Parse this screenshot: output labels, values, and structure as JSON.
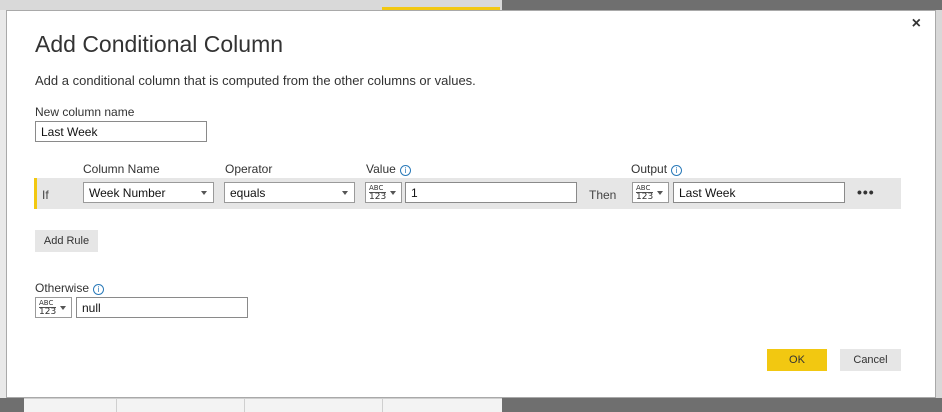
{
  "dialog": {
    "title": "Add Conditional Column",
    "description": "Add a conditional column that is computed from the other columns or values.",
    "close_icon": "×"
  },
  "new_column": {
    "label": "New column name",
    "value": "Last Week"
  },
  "headers": {
    "column_name": "Column Name",
    "operator": "Operator",
    "value": "Value",
    "output": "Output",
    "info_icon": "i"
  },
  "rule": {
    "if_label": "If",
    "column": "Week Number",
    "operator": "equals",
    "value_type_top": "ABC",
    "value_type_bottom": "123",
    "value": "1",
    "then_label": "Then",
    "output_type_top": "ABC",
    "output_type_bottom": "123",
    "output": "Last Week",
    "more": "•••"
  },
  "add_rule_label": "Add Rule",
  "otherwise": {
    "label": "Otherwise",
    "type_top": "ABC",
    "type_bottom": "123",
    "value": "null"
  },
  "buttons": {
    "ok": "OK",
    "cancel": "Cancel"
  },
  "colors": {
    "accent": "#f2c811",
    "info": "#2a7ab9"
  }
}
